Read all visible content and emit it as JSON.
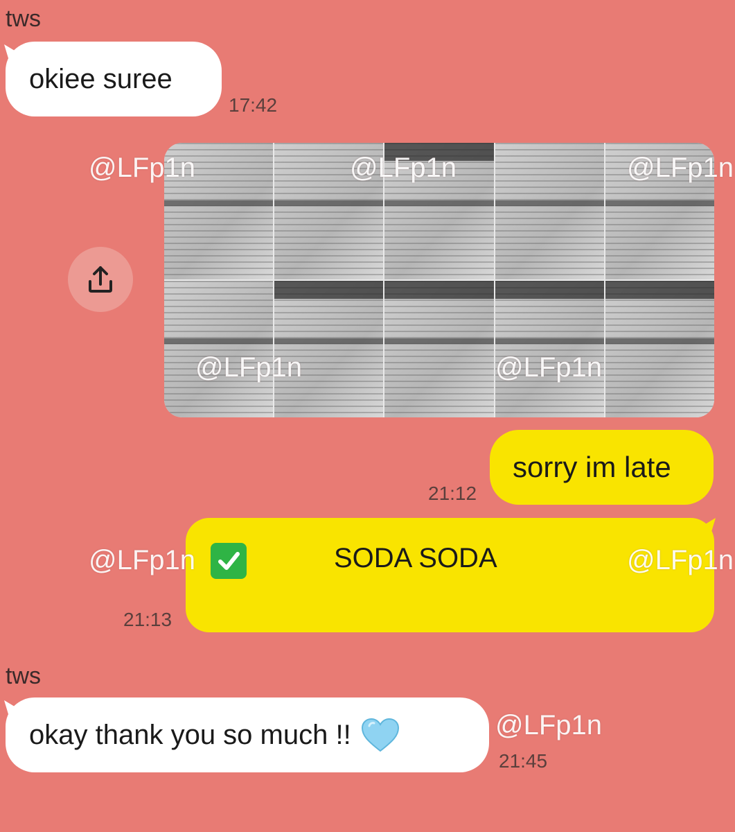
{
  "chat": {
    "messages": [
      {
        "sender": "tws",
        "text": "okiee suree",
        "time": "17:42"
      },
      {
        "time": "",
        "share_icon": "share-icon"
      },
      {
        "text": "sorry im late",
        "time": "21:12"
      },
      {
        "text": "SODA SODA",
        "time": "21:13",
        "emoji": "check-mark-icon"
      },
      {
        "sender": "tws",
        "text": "okay thank you so much !!",
        "time": "21:45",
        "emoji": "light-blue-heart-icon"
      }
    ]
  },
  "watermark": "@LFp1n",
  "colors": {
    "background": "#e87b74",
    "incoming_bubble": "#ffffff",
    "outgoing_bubble": "#f9e400",
    "check": "#2fb445",
    "heart": "#8fd3f2"
  }
}
